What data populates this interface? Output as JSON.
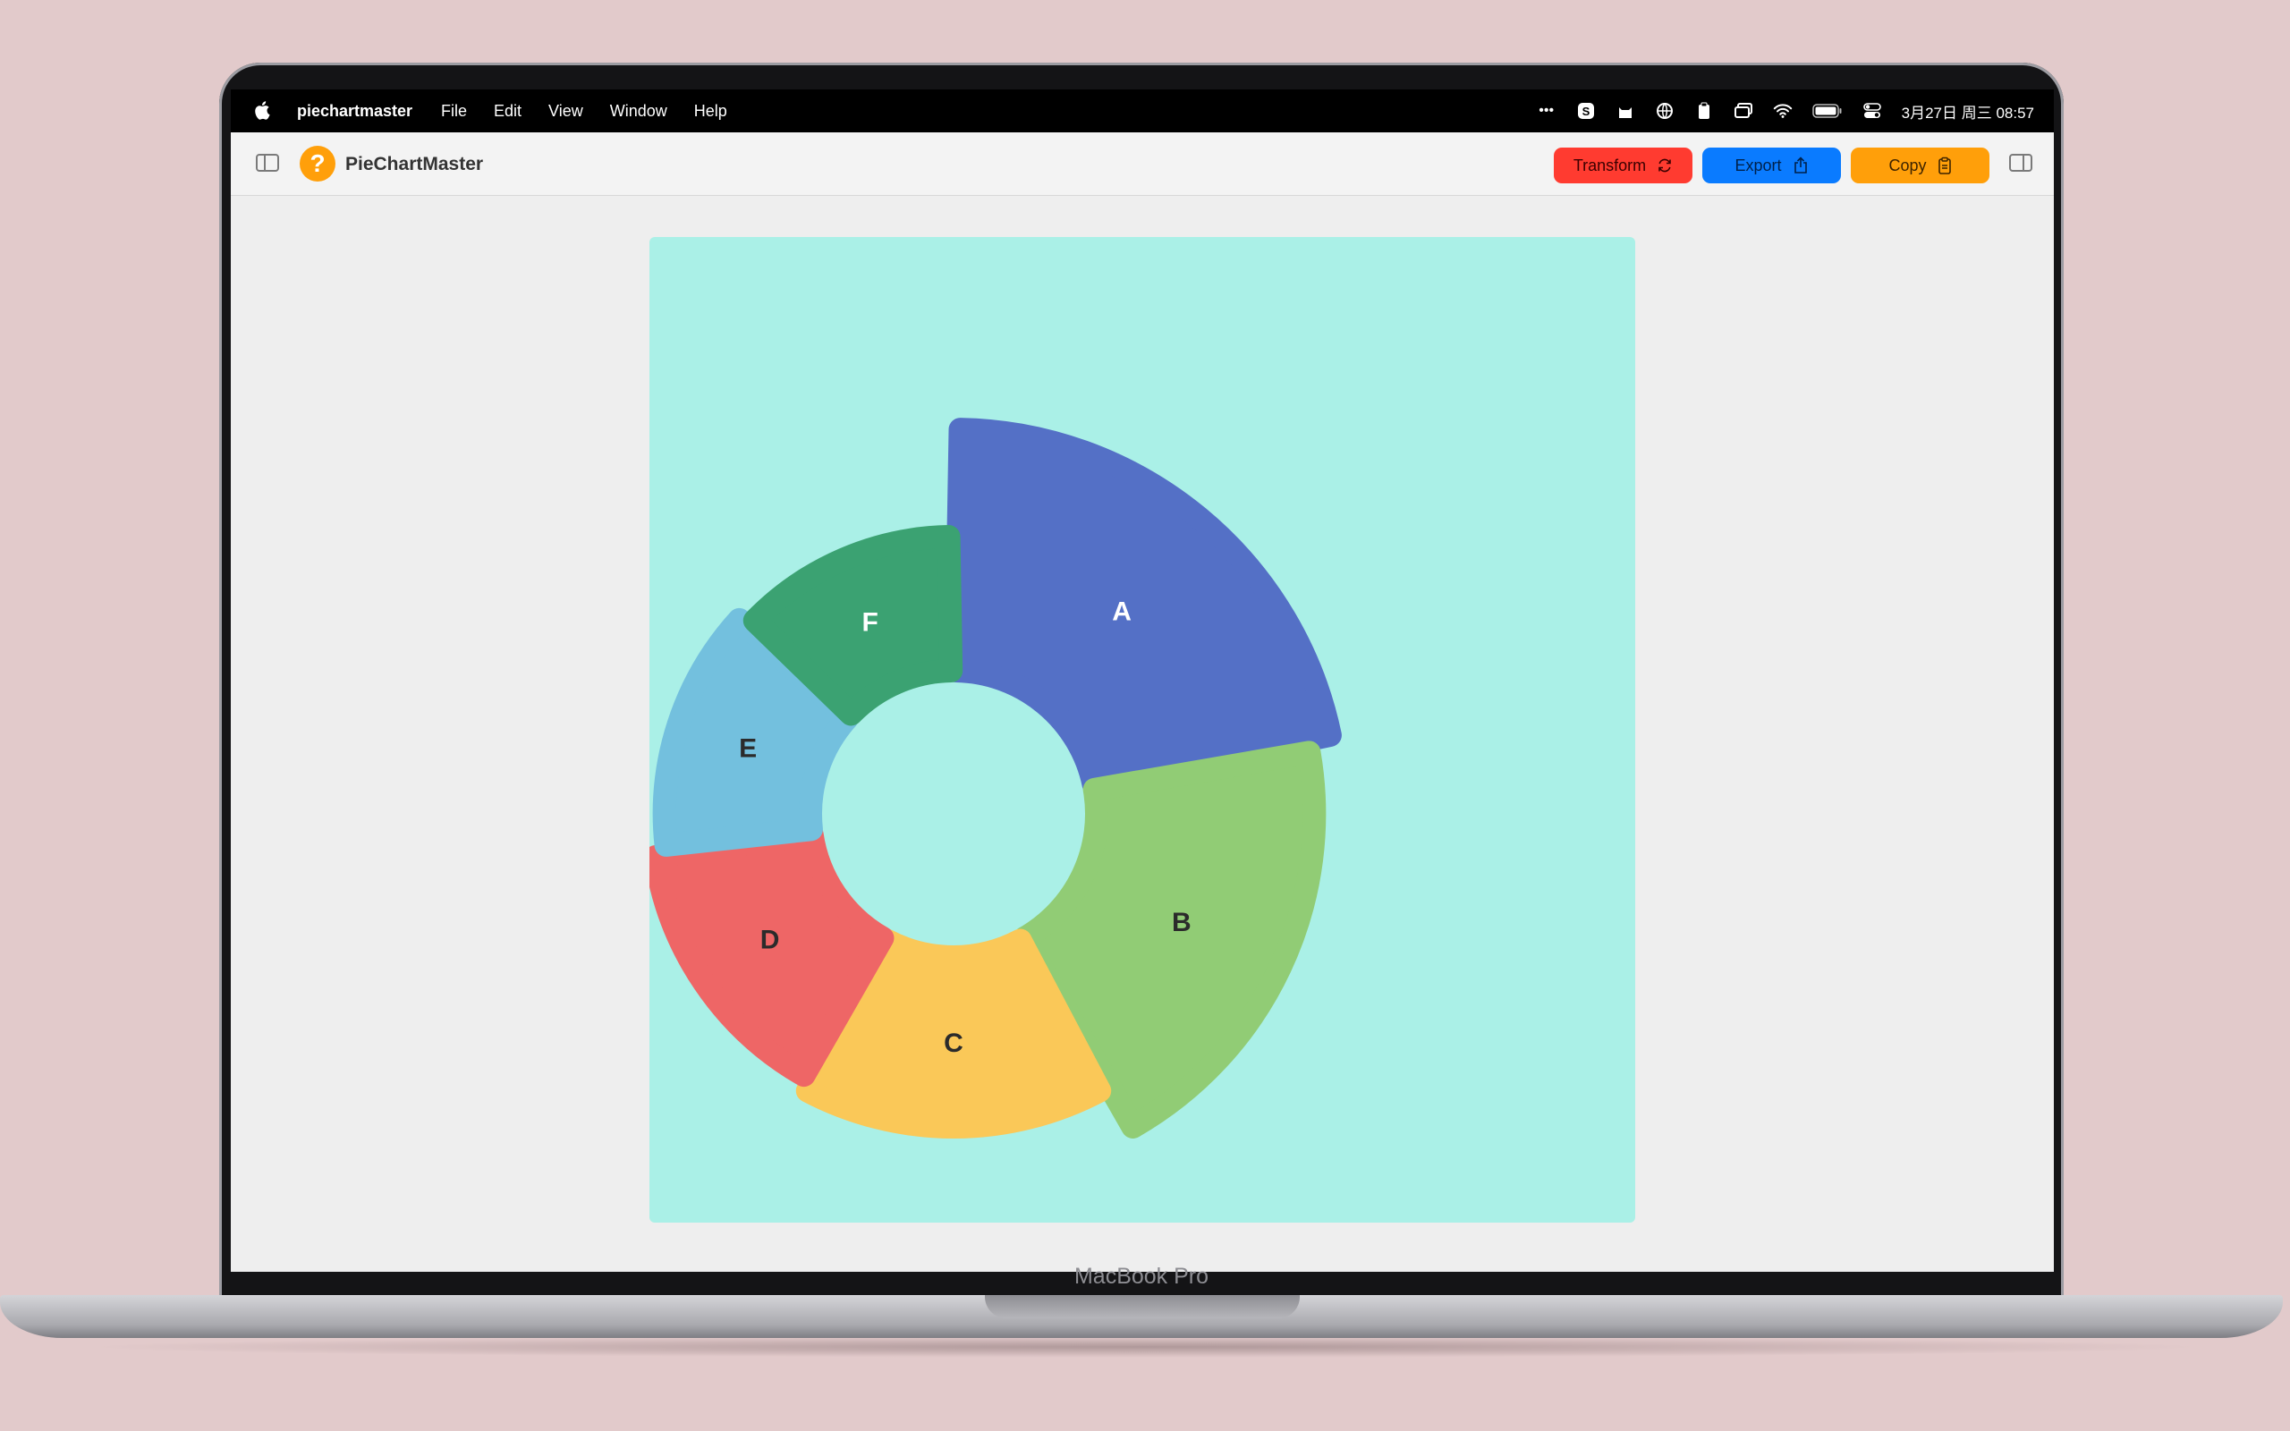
{
  "device": {
    "brand_label": "MacBook Pro"
  },
  "menubar": {
    "app_name": "piechartmaster",
    "menus": [
      "File",
      "Edit",
      "View",
      "Window",
      "Help"
    ],
    "status_icons": [
      "more-icon",
      "skype-icon",
      "cat-icon",
      "globe-icon",
      "clipboard-icon",
      "window-icon",
      "wifi-icon",
      "battery-icon",
      "control-center-icon"
    ],
    "clock": "3月27日 周三 08:57"
  },
  "toolbar": {
    "title": "PieChartMaster",
    "logo_glyph": "?",
    "transform_label": "Transform",
    "export_label": "Export",
    "copy_label": "Copy"
  },
  "colors": {
    "canvas_bg": "#aaf0e7",
    "transform": "#ff3b30",
    "export": "#0a7bff",
    "copy": "#ff9f0a"
  },
  "chart_data": {
    "type": "pie",
    "variant": "donut",
    "slices": [
      {
        "label": "A",
        "value": 22,
        "color": "#5470c6",
        "label_color": "#ffffff"
      },
      {
        "label": "B",
        "value": 20,
        "color": "#91cc75",
        "label_color": "#2b2b2b"
      },
      {
        "label": "C",
        "value": 16,
        "color": "#fac858",
        "label_color": "#2b2b2b"
      },
      {
        "label": "D",
        "value": 15,
        "color": "#ee6666",
        "label_color": "#2b2b2b"
      },
      {
        "label": "E",
        "value": 14,
        "color": "#73c0de",
        "label_color": "#2b2b2b"
      },
      {
        "label": "F",
        "value": 13,
        "color": "#3ba272",
        "label_color": "#ffffff"
      }
    ]
  }
}
